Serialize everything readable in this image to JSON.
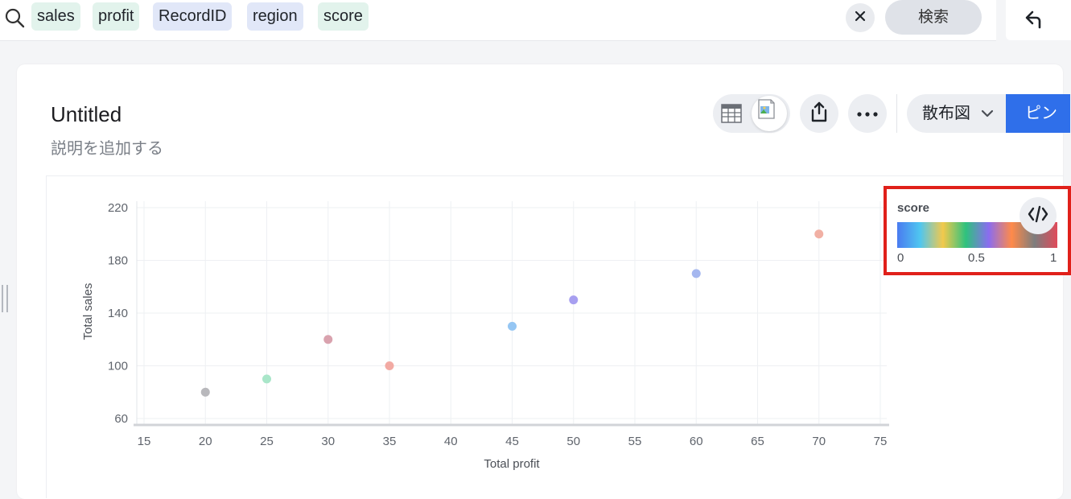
{
  "search": {
    "tokens": [
      {
        "label": "sales",
        "kind": "measure"
      },
      {
        "label": "profit",
        "kind": "measure"
      },
      {
        "label": "RecordID",
        "kind": "attribute"
      },
      {
        "label": "region",
        "kind": "attribute"
      },
      {
        "label": "score",
        "kind": "measure"
      }
    ],
    "clear_icon": "close-icon",
    "search_label": "検索",
    "back_icon": "undo-arrow-icon"
  },
  "card": {
    "title": "Untitled",
    "subtitle": "説明を追加する",
    "toolbar": {
      "table_icon": "table-icon",
      "chart_icon": "broken-image-icon",
      "share_icon": "share-icon",
      "more_icon": "more-icon",
      "chart_type_label": "散布図",
      "pin_label": "ピン"
    }
  },
  "legend": {
    "title": "score",
    "ticks": [
      "0",
      "0.5",
      "1"
    ],
    "code_icon": "code-icon",
    "gradient_colors": [
      "#4a7bf0",
      "#4fc6f0",
      "#f2c94c",
      "#2ec27e",
      "#8a6cf0",
      "#ff8a4a",
      "#7d7d7d",
      "#e04a5a"
    ]
  },
  "colors": {
    "accent": "#2f6fea",
    "highlight_border": "#e0201a",
    "token_measure": "#e2f3ec",
    "token_attribute": "#e1e7f8"
  },
  "chart_data": {
    "type": "scatter",
    "xlabel": "Total profit",
    "ylabel": "Total sales",
    "xlim": [
      15,
      75
    ],
    "ylim": [
      60,
      220
    ],
    "x_ticks": [
      15,
      20,
      25,
      30,
      35,
      40,
      45,
      50,
      55,
      60,
      65,
      70,
      75
    ],
    "y_ticks": [
      60,
      100,
      140,
      180,
      220
    ],
    "grid": true,
    "legend_position": "top-right",
    "points": [
      {
        "x": 20,
        "y": 80,
        "color": "#b8b8bc"
      },
      {
        "x": 25,
        "y": 90,
        "color": "#a9e6c9"
      },
      {
        "x": 30,
        "y": 120,
        "color": "#d9a2ae"
      },
      {
        "x": 35,
        "y": 100,
        "color": "#f2aaa3"
      },
      {
        "x": 45,
        "y": 130,
        "color": "#95c6f3"
      },
      {
        "x": 50,
        "y": 150,
        "color": "#a79ff0"
      },
      {
        "x": 60,
        "y": 170,
        "color": "#a5b7ef"
      },
      {
        "x": 70,
        "y": 200,
        "color": "#f1b0a4"
      }
    ]
  }
}
